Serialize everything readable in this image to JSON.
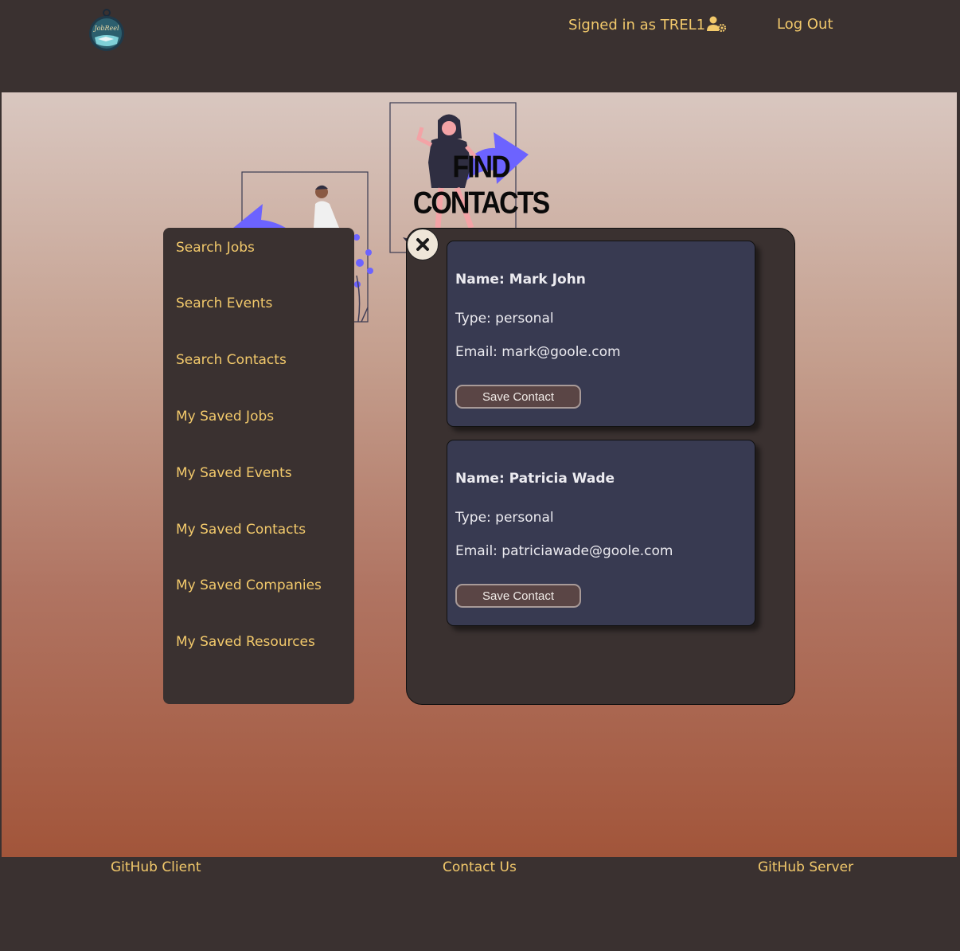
{
  "header": {
    "logo_text": "JobReel",
    "signed_in": "Signed in as TREL1",
    "logout": "Log Out"
  },
  "page": {
    "title": "FIND CONTACTS"
  },
  "sidebar": {
    "items": [
      {
        "label": "Search Jobs"
      },
      {
        "label": "Search Events"
      },
      {
        "label": "Search Contacts"
      },
      {
        "label": "My Saved Jobs"
      },
      {
        "label": "My Saved Events"
      },
      {
        "label": "My Saved Contacts"
      },
      {
        "label": "My Saved Companies"
      },
      {
        "label": "My Saved Resources"
      }
    ]
  },
  "contacts": [
    {
      "name": "Name: Mark John",
      "type": "Type: personal",
      "email": "Email: mark@goole.com",
      "button": "Save Contact"
    },
    {
      "name": "Name: Patricia Wade",
      "type": "Type: personal",
      "email": "Email: patriciawade@goole.com",
      "button": "Save Contact"
    }
  ],
  "footer": {
    "client": "GitHub Client",
    "contact": "Contact Us",
    "server": "GitHub Server"
  },
  "colors": {
    "dark": "#3a3130",
    "accent": "#f2c96b",
    "card": "#383a51",
    "illustration": "#6c63ff"
  },
  "icons": [
    "user-gear-icon",
    "close-icon",
    "jobreel-logo"
  ]
}
